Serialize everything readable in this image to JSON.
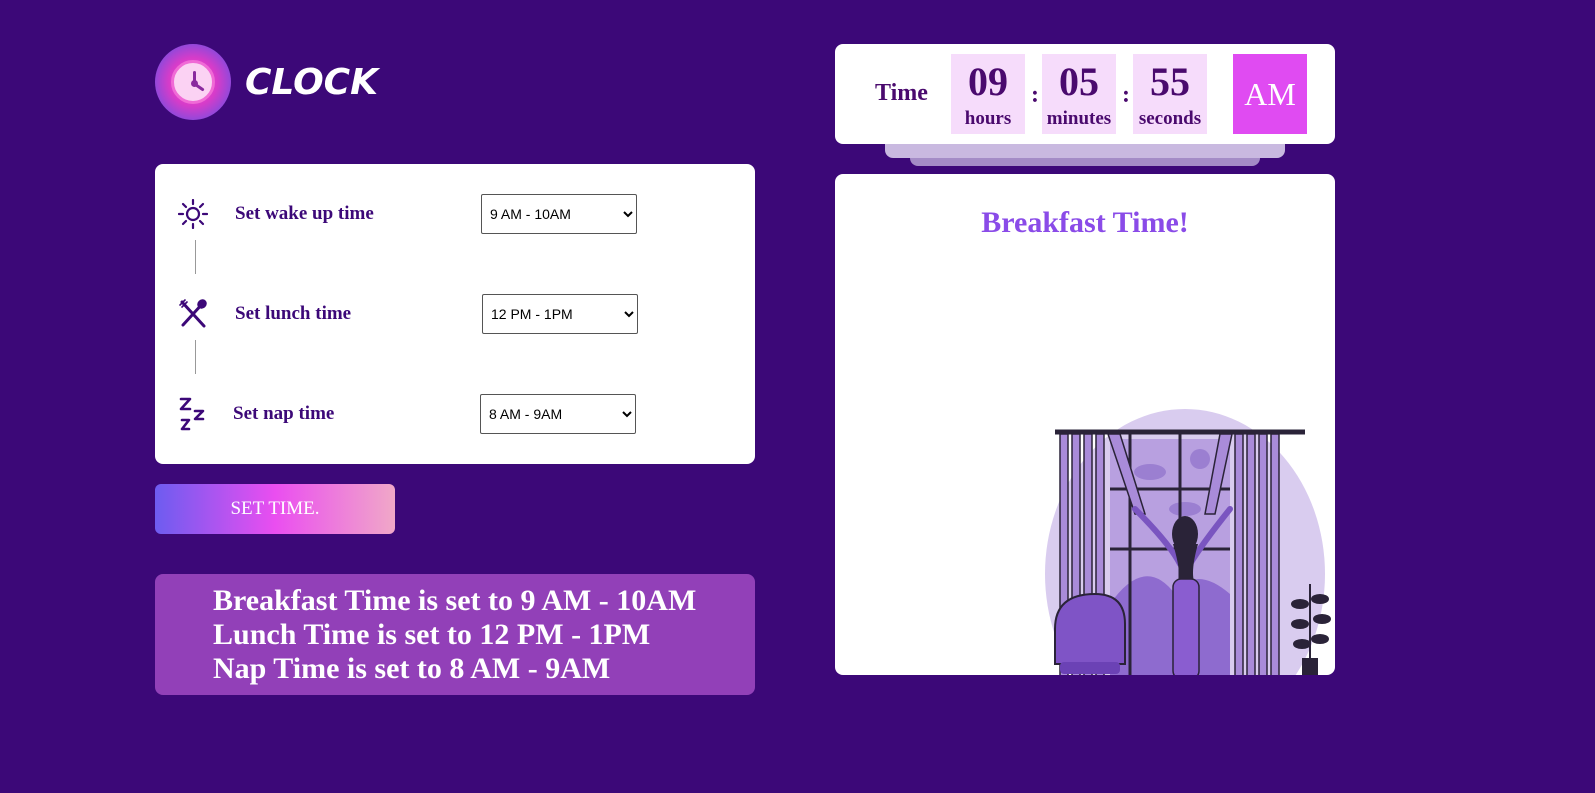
{
  "logo": {
    "text": "CLOCK",
    "icon": "alarm-clock-icon"
  },
  "settings": {
    "wake": {
      "label": "Set wake up time",
      "value": "9 AM - 10AM",
      "icon": "sun-icon"
    },
    "lunch": {
      "label": "Set lunch time",
      "value": "12 PM - 1PM",
      "icon": "fork-spoon-icon"
    },
    "nap": {
      "label": "Set nap time",
      "value": "8 AM - 9AM",
      "icon": "zzz-icon"
    }
  },
  "set_button": "SET TIME.",
  "summary": {
    "line1": "Breakfast Time is set to 9 AM - 10AM",
    "line2": "Lunch Time is set to 12 PM - 1PM",
    "line3": "Nap Time is set to 8 AM - 9AM"
  },
  "clock": {
    "label": "Time",
    "hours": "09",
    "hours_label": "hours",
    "minutes": "05",
    "minutes_label": "minutes",
    "seconds": "55",
    "seconds_label": "seconds",
    "separator": ":",
    "period": "AM"
  },
  "panel": {
    "title": "Breakfast Time!"
  },
  "colors": {
    "background": "#3c0878",
    "accent": "#8a4be8",
    "ampm": "#e04bf2",
    "summary": "#9240b8"
  }
}
